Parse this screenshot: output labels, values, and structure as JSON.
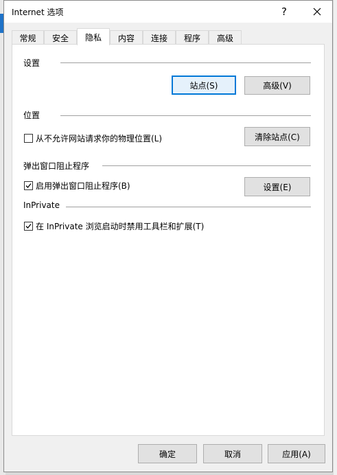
{
  "window": {
    "title": "Internet 选项",
    "help_glyph": "?",
    "close_glyph": "✕"
  },
  "tabs": [
    {
      "label": "常规",
      "active": false
    },
    {
      "label": "安全",
      "active": false
    },
    {
      "label": "隐私",
      "active": true
    },
    {
      "label": "内容",
      "active": false
    },
    {
      "label": "连接",
      "active": false
    },
    {
      "label": "程序",
      "active": false
    },
    {
      "label": "高级",
      "active": false
    }
  ],
  "settings": {
    "title": "设置",
    "sites_button": "站点(S)",
    "advanced_button": "高级(V)"
  },
  "location": {
    "title": "位置",
    "checkbox_label": "从不允许网站请求你的物理位置(L)",
    "checked": false,
    "clear_button": "清除站点(C)"
  },
  "popup": {
    "title": "弹出窗口阻止程序",
    "checkbox_label": "启用弹出窗口阻止程序(B)",
    "checked": true,
    "settings_button": "设置(E)"
  },
  "inprivate": {
    "title": "InPrivate",
    "checkbox_label": "在 InPrivate 浏览启动时禁用工具栏和扩展(T)",
    "checked": true
  },
  "footer": {
    "ok_button": "确定",
    "cancel_button": "取消",
    "apply_button": "应用(A)"
  },
  "colors": {
    "accent": "#0078d7",
    "window_bg": "#f0f0f0",
    "panel_bg": "#ffffff"
  }
}
